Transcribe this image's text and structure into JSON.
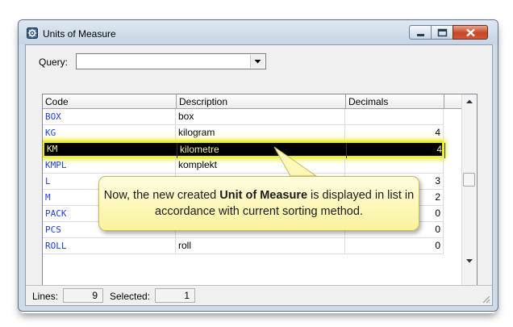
{
  "window": {
    "title": "Units of Measure",
    "icon": "settings-gear-icon"
  },
  "query": {
    "label": "Query:",
    "value": ""
  },
  "table": {
    "columns": [
      "Code",
      "Description",
      "Decimals"
    ],
    "rows": [
      {
        "code": "BOX",
        "description": "box",
        "decimals": ""
      },
      {
        "code": "KG",
        "description": "kilogram",
        "decimals": "4"
      },
      {
        "code": "KM",
        "description": "kilometre",
        "decimals": "4",
        "selected": true
      },
      {
        "code": "KMPL",
        "description": "komplekt",
        "decimals": ""
      },
      {
        "code": "L",
        "description": "",
        "decimals": "3"
      },
      {
        "code": "M",
        "description": "",
        "decimals": "2"
      },
      {
        "code": "PACK",
        "description": "",
        "decimals": "0"
      },
      {
        "code": "PCS",
        "description": "",
        "decimals": "0"
      },
      {
        "code": "ROLL",
        "description": "roll",
        "decimals": "0"
      }
    ]
  },
  "status": {
    "lines_label": "Lines:",
    "lines_value": "9",
    "selected_label": "Selected:",
    "selected_value": "1"
  },
  "callout": {
    "text_before": "Now, the new created ",
    "text_bold": "Unit of Measure",
    "text_after": " is displayed in list in accordance with current sorting method."
  },
  "colors": {
    "code_text": "#1f3fd8",
    "highlight": "#f2f200",
    "callout_bg": "#fbf29c",
    "close_button": "#c84526"
  }
}
